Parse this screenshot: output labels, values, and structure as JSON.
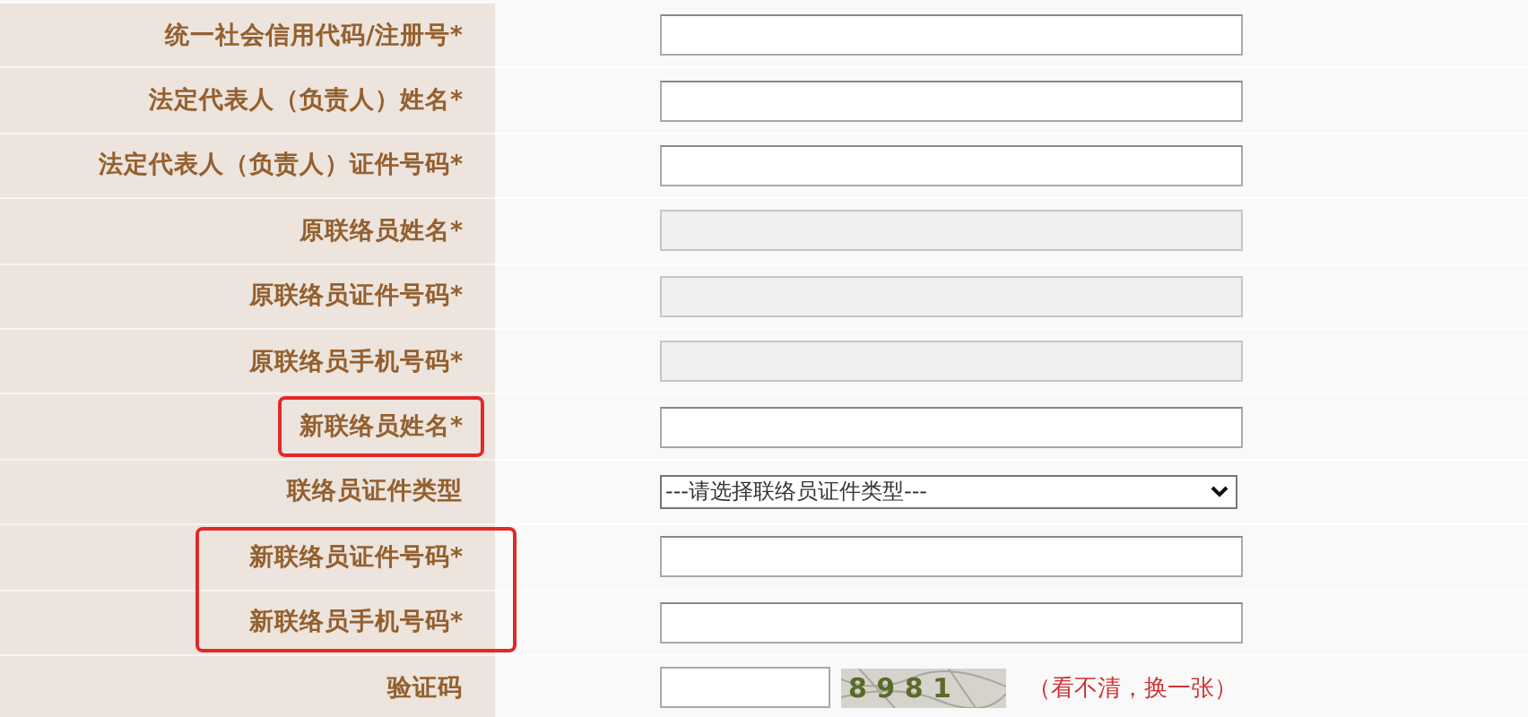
{
  "rows": [
    {
      "label": "统一社会信用代码/注册号*",
      "field": {
        "kind": "text",
        "disabled": false
      },
      "highlighted": false
    },
    {
      "label": "法定代表人（负责人）姓名*",
      "field": {
        "kind": "text",
        "disabled": false
      },
      "highlighted": false
    },
    {
      "label": "法定代表人（负责人）证件号码*",
      "field": {
        "kind": "text",
        "disabled": false
      },
      "highlighted": false
    },
    {
      "label": "原联络员姓名*",
      "field": {
        "kind": "text",
        "disabled": true
      },
      "highlighted": false
    },
    {
      "label": "原联络员证件号码*",
      "field": {
        "kind": "text",
        "disabled": true
      },
      "highlighted": false
    },
    {
      "label": "原联络员手机号码*",
      "field": {
        "kind": "text",
        "disabled": true
      },
      "highlighted": false
    },
    {
      "label": "新联络员姓名*",
      "field": {
        "kind": "text",
        "disabled": false
      },
      "highlighted": true
    },
    {
      "label": "联络员证件类型",
      "field": {
        "kind": "select",
        "value": "---请选择联络员证件类型---"
      },
      "highlighted": false
    },
    {
      "label": "新联络员证件号码*",
      "field": {
        "kind": "text",
        "disabled": false
      },
      "highlighted": true
    },
    {
      "label": "新联络员手机号码*",
      "field": {
        "kind": "text",
        "disabled": false
      },
      "highlighted": true
    },
    {
      "label": "验证码",
      "field": {
        "kind": "captcha",
        "code": "8 9 8 1",
        "refresh": "（看不清，换一张）"
      },
      "highlighted": false
    }
  ]
}
